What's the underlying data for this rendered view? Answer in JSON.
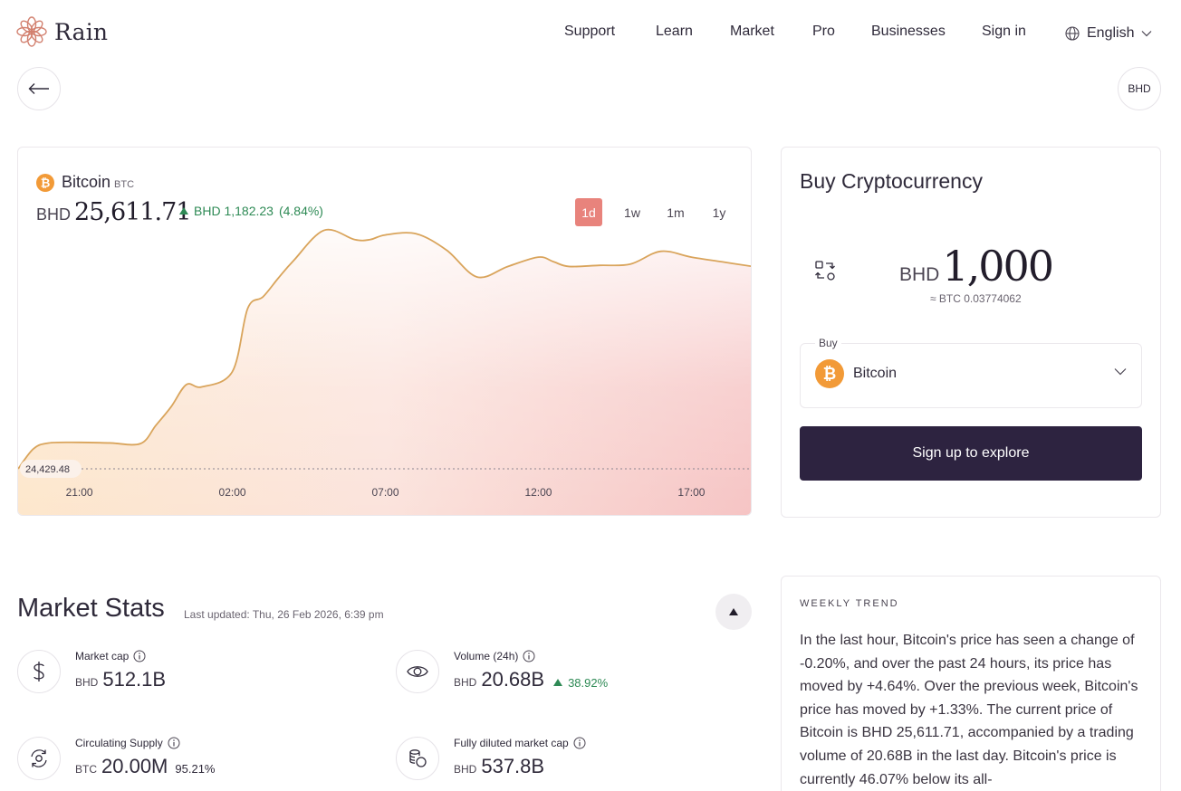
{
  "header": {
    "brand": "Rain",
    "nav": [
      "Support",
      "Learn",
      "Market",
      "Pro",
      "Businesses",
      "Sign in"
    ],
    "language": "English"
  },
  "top_controls": {
    "currency_badge": "BHD"
  },
  "chart_card": {
    "coin_name": "Bitcoin",
    "coin_symbol": "BTC",
    "currency": "BHD",
    "price": "25,611.71",
    "change_amount": "BHD 1,182.23",
    "change_percent": "(4.84%)",
    "ranges": [
      "1d",
      "1w",
      "1m",
      "1y"
    ],
    "active_range": "1d"
  },
  "chart_data": {
    "type": "area",
    "x_tick_labels": [
      "21:00",
      "02:00",
      "07:00",
      "12:00",
      "17:00"
    ],
    "baseline_label": "24,429.48",
    "baseline_value": 24429.48,
    "x_hours": [
      0,
      0.5,
      1,
      2,
      3,
      4,
      4.5,
      5,
      5.5,
      6,
      7,
      7.5,
      8,
      8.5,
      9,
      10,
      11,
      11.5,
      12,
      13,
      14,
      15,
      16,
      17,
      17.5,
      18,
      19,
      20,
      21,
      22,
      23,
      24
    ],
    "values": [
      24429,
      24600,
      24650,
      24655,
      24650,
      24645,
      24800,
      24960,
      25150,
      25130,
      25260,
      25800,
      25900,
      26060,
      26210,
      26470,
      26390,
      26390,
      26430,
      26440,
      26300,
      26070,
      26160,
      26240,
      26200,
      26160,
      26170,
      26180,
      26290,
      26240,
      26200,
      26160
    ],
    "line_color": "#d9a45b",
    "fill_top": "#f4c6c6",
    "fill_bottom": "#fde8cf"
  },
  "buy_card": {
    "title": "Buy Cryptocurrency",
    "currency": "BHD",
    "amount": "1,000",
    "conversion": "≈ BTC 0.03774062",
    "select_label": "Buy",
    "selected_coin": "Bitcoin",
    "cta": "Sign up to explore",
    "cta_color": "#2d2340"
  },
  "market_stats": {
    "title": "Market Stats",
    "last_updated": "Last updated: Thu, 26 Feb 2026, 6:39 pm",
    "items": [
      {
        "label": "Market cap",
        "currency": "BHD",
        "value": "512.1B",
        "icon": "dollar-icon"
      },
      {
        "label": "Volume (24h)",
        "currency": "BHD",
        "value": "20.68B",
        "change": "38.92%",
        "icon": "eye-icon"
      },
      {
        "label": "Circulating Supply",
        "currency": "BTC",
        "value": "20.00M",
        "extra": "95.21%",
        "icon": "cycle-icon"
      },
      {
        "label": "Fully diluted market cap",
        "currency": "BHD",
        "value": "537.8B",
        "icon": "coins-icon"
      }
    ]
  },
  "weekly_trend": {
    "heading": "WEEKLY TREND",
    "text": "In the last hour, Bitcoin's price has seen a change of -0.20%, and over the past 24 hours, its price has moved by +4.64%. Over the previous week, Bitcoin's price has moved by +1.33%. The current price of Bitcoin is BHD 25,611.71, accompanied by a trading volume of 20.68B in the last day. Bitcoin's price is currently 46.07% below its all-"
  },
  "colors": {
    "accent": "#e8837c",
    "positive": "#2e8a55",
    "bitcoin": "#f29a37",
    "dark": "#2d2340"
  }
}
